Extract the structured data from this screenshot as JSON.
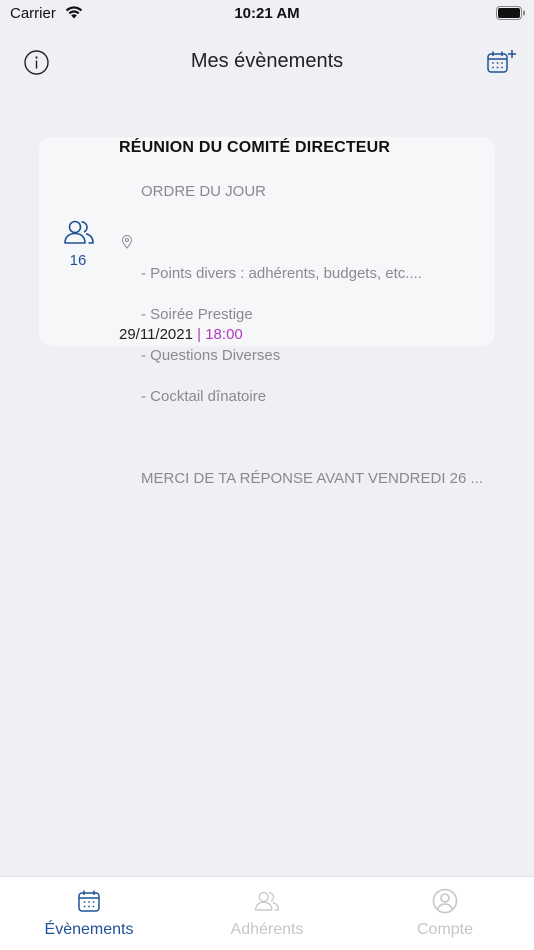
{
  "status_bar": {
    "carrier": "Carrier",
    "time": "10:21 AM"
  },
  "nav": {
    "title": "Mes évènements",
    "info_icon": "info-circle-icon",
    "add_icon": "calendar-add-icon"
  },
  "event": {
    "title": "RÉUNION DU COMITÉ DIRECTEUR",
    "description_lines": [
      "ORDRE DU JOUR",
      "",
      "- Points divers : adhérents, budgets, etc....",
      "- Soirée Prestige",
      "- Questions Diverses",
      "- Cocktail dînatoire",
      "",
      "MERCI DE TA RÉPONSE AVANT VENDREDI 26 ..."
    ],
    "participants_count": "16",
    "date": "29/11/2021",
    "separator": "|",
    "time": "18:00"
  },
  "tabs": [
    {
      "label": "Évènements",
      "icon": "calendar-icon",
      "active": true
    },
    {
      "label": "Adhérents",
      "icon": "members-icon",
      "active": false
    },
    {
      "label": "Compte",
      "icon": "account-icon",
      "active": false
    }
  ],
  "colors": {
    "accent": "#1F5196",
    "time_accent": "#B13BC1",
    "background": "#EFF0F4",
    "inactive": "#C5C5CA"
  }
}
